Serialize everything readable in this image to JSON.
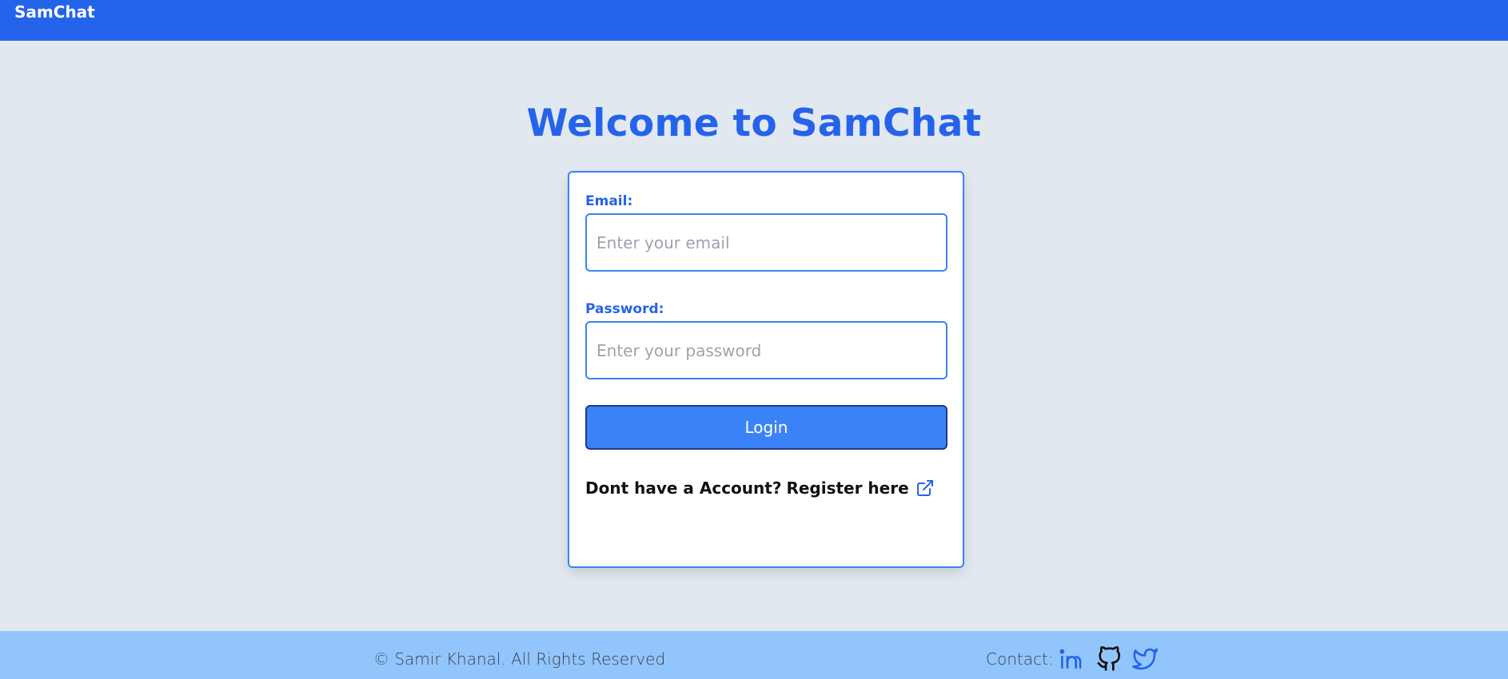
{
  "navbar": {
    "brand": "SamChat",
    "color": "#2563eb"
  },
  "main": {
    "heading": "Welcome to SamChat"
  },
  "login_form": {
    "email_label": "Email:",
    "email_placeholder": "Enter your email",
    "email_value": "",
    "password_label": "Password:",
    "password_placeholder": "Enter your password",
    "password_value": "",
    "login_button": "Login",
    "register_prompt": "Dont have a Account?",
    "register_link": "Register here",
    "register_icon": "external-link-icon"
  },
  "footer": {
    "copyright": "© Samir Khanal. All Rights Reserved",
    "contact_label": "Contact:",
    "social_icons": [
      "linkedin-icon",
      "github-icon",
      "twitter-icon"
    ],
    "color": "#93c5fd"
  },
  "colors": {
    "accent": "#2563eb",
    "button": "#3b82f6",
    "background": "#e2e8f0"
  }
}
